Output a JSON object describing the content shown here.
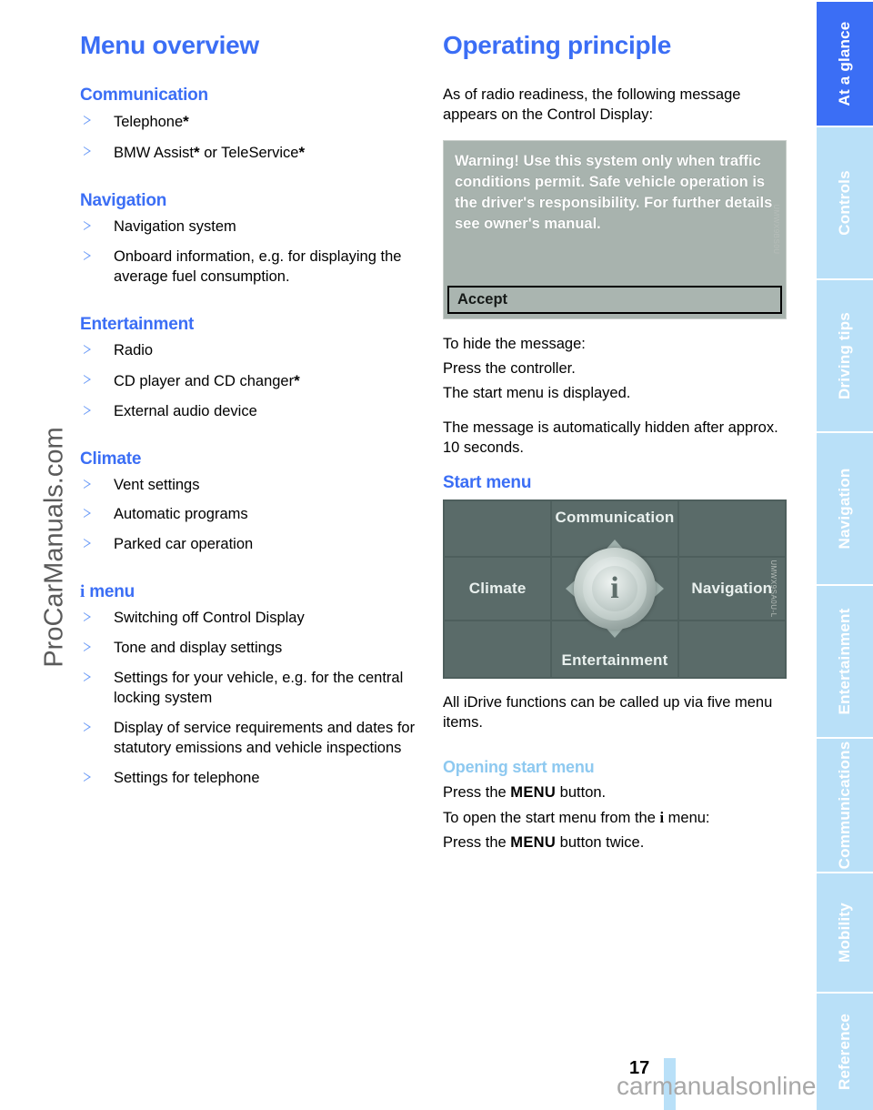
{
  "page": {
    "number": "17",
    "watermark_left": "ProCarManuals.com",
    "watermark_bottom": "carmanualsonline.info"
  },
  "sidebar": {
    "tabs": [
      {
        "label": "At a glance",
        "active": true
      },
      {
        "label": "Controls",
        "active": false
      },
      {
        "label": "Driving tips",
        "active": false
      },
      {
        "label": "Navigation",
        "active": false
      },
      {
        "label": "Entertainment",
        "active": false
      },
      {
        "label": "Communications",
        "active": false
      },
      {
        "label": "Mobility",
        "active": false
      },
      {
        "label": "Reference",
        "active": false
      }
    ],
    "active_color": "#3b6ef5",
    "inactive_color": "#b9e0f8"
  },
  "left_column": {
    "title": "Menu overview",
    "sections": [
      {
        "heading": "Communication",
        "items": [
          "Telephone*",
          "BMW Assist* or TeleService*"
        ]
      },
      {
        "heading": "Navigation",
        "items": [
          "Navigation system",
          "Onboard information, e.g. for displaying the average fuel consumption."
        ]
      },
      {
        "heading": "Entertainment",
        "items": [
          "Radio",
          "CD player and CD changer*",
          "External audio device"
        ]
      },
      {
        "heading": "Climate",
        "items": [
          "Vent settings",
          "Automatic programs",
          "Parked car operation"
        ]
      },
      {
        "heading": "menu",
        "heading_prefix_icon": "i",
        "items": [
          "Switching off Control Display",
          "Tone and display settings",
          "Settings for your vehicle, e.g. for the central locking system",
          "Display of service requirements and dates for statutory emissions and vehicle inspections",
          "Settings for telephone"
        ]
      }
    ]
  },
  "right_column": {
    "title": "Operating principle",
    "intro": "As of radio readiness, the following message appears on the Control Display:",
    "warning_figure": {
      "message": "Warning! Use this system only when traffic conditions permit. Safe vehicle operation is the driver's responsibility. For further details see owner's manual.",
      "button_label": "Accept",
      "background_color": "#a8b3ae",
      "code": "UMWX9BS0U"
    },
    "hide_message_lines": [
      "To hide the message:",
      "Press the controller.",
      "The start menu is displayed."
    ],
    "auto_hide": "The message is automatically hidden after approx. 10 seconds.",
    "start_menu_heading": "Start menu",
    "start_menu_figure": {
      "top": "Communication",
      "left": "Climate",
      "right": "Navigation",
      "bottom": "Entertainment",
      "center_icon": "i",
      "background_color": "#4e5f5d",
      "code": "UMWX9SA0U-L"
    },
    "start_menu_note": "All iDrive functions can be called up via five menu items.",
    "opening_heading": "Opening start menu",
    "opening_lines": [
      {
        "pre": "Press the ",
        "bold": "MENU",
        "post": " button."
      },
      {
        "pre": "To open the start menu from the ",
        "icon": "i",
        "post": " menu:"
      },
      {
        "pre": "Press the ",
        "bold": "MENU",
        "post": " button twice."
      }
    ]
  }
}
